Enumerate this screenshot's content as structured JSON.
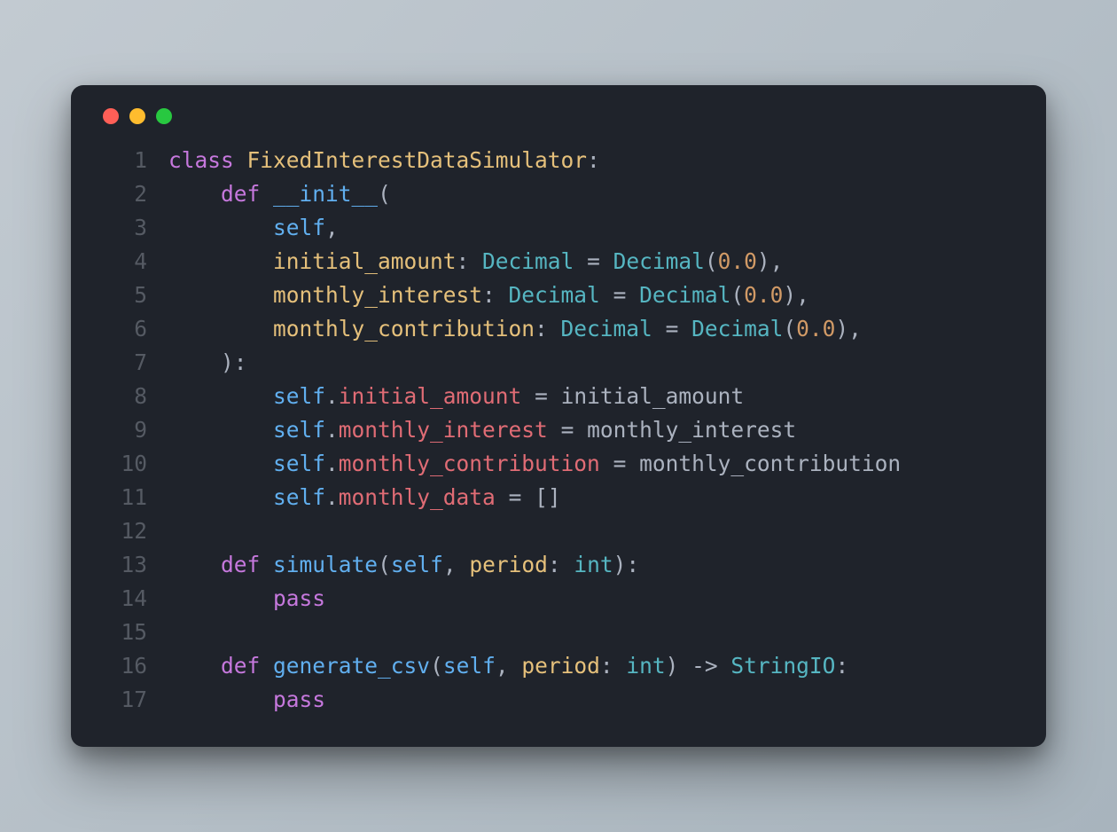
{
  "lines": [
    {
      "n": 1,
      "tokens": [
        [
          "kw",
          "class"
        ],
        [
          "op",
          " "
        ],
        [
          "cls",
          "FixedInterestDataSimulator"
        ],
        [
          "op",
          ":"
        ]
      ]
    },
    {
      "n": 2,
      "tokens": [
        [
          "op",
          "    "
        ],
        [
          "kw",
          "def"
        ],
        [
          "op",
          " "
        ],
        [
          "fn",
          "__init__"
        ],
        [
          "op",
          "("
        ]
      ]
    },
    {
      "n": 3,
      "tokens": [
        [
          "op",
          "        "
        ],
        [
          "slf",
          "self"
        ],
        [
          "op",
          ","
        ]
      ]
    },
    {
      "n": 4,
      "tokens": [
        [
          "op",
          "        "
        ],
        [
          "prm",
          "initial_amount"
        ],
        [
          "op",
          ": "
        ],
        [
          "typ",
          "Decimal"
        ],
        [
          "op",
          " = "
        ],
        [
          "call",
          "Decimal"
        ],
        [
          "op",
          "("
        ],
        [
          "num",
          "0.0"
        ],
        [
          "op",
          "),"
        ]
      ]
    },
    {
      "n": 5,
      "tokens": [
        [
          "op",
          "        "
        ],
        [
          "prm",
          "monthly_interest"
        ],
        [
          "op",
          ": "
        ],
        [
          "typ",
          "Decimal"
        ],
        [
          "op",
          " = "
        ],
        [
          "call",
          "Decimal"
        ],
        [
          "op",
          "("
        ],
        [
          "num",
          "0.0"
        ],
        [
          "op",
          "),"
        ]
      ]
    },
    {
      "n": 6,
      "tokens": [
        [
          "op",
          "        "
        ],
        [
          "prm",
          "monthly_contribution"
        ],
        [
          "op",
          ": "
        ],
        [
          "typ",
          "Decimal"
        ],
        [
          "op",
          " = "
        ],
        [
          "call",
          "Decimal"
        ],
        [
          "op",
          "("
        ],
        [
          "num",
          "0.0"
        ],
        [
          "op",
          "),"
        ]
      ]
    },
    {
      "n": 7,
      "tokens": [
        [
          "op",
          "    ):"
        ]
      ]
    },
    {
      "n": 8,
      "tokens": [
        [
          "op",
          "        "
        ],
        [
          "slf",
          "self"
        ],
        [
          "op",
          "."
        ],
        [
          "attr",
          "initial_amount"
        ],
        [
          "op",
          " = "
        ],
        [
          "id",
          "initial_amount"
        ]
      ]
    },
    {
      "n": 9,
      "tokens": [
        [
          "op",
          "        "
        ],
        [
          "slf",
          "self"
        ],
        [
          "op",
          "."
        ],
        [
          "attr",
          "monthly_interest"
        ],
        [
          "op",
          " = "
        ],
        [
          "id",
          "monthly_interest"
        ]
      ]
    },
    {
      "n": 10,
      "tokens": [
        [
          "op",
          "        "
        ],
        [
          "slf",
          "self"
        ],
        [
          "op",
          "."
        ],
        [
          "attr",
          "monthly_contribution"
        ],
        [
          "op",
          " = "
        ],
        [
          "id",
          "monthly_contribution"
        ]
      ]
    },
    {
      "n": 11,
      "tokens": [
        [
          "op",
          "        "
        ],
        [
          "slf",
          "self"
        ],
        [
          "op",
          "."
        ],
        [
          "attr",
          "monthly_data"
        ],
        [
          "op",
          " = []"
        ]
      ]
    },
    {
      "n": 12,
      "tokens": [
        [
          "op",
          ""
        ]
      ]
    },
    {
      "n": 13,
      "tokens": [
        [
          "op",
          "    "
        ],
        [
          "kw",
          "def"
        ],
        [
          "op",
          " "
        ],
        [
          "fn",
          "simulate"
        ],
        [
          "op",
          "("
        ],
        [
          "slf",
          "self"
        ],
        [
          "op",
          ", "
        ],
        [
          "prm",
          "period"
        ],
        [
          "op",
          ": "
        ],
        [
          "typ",
          "int"
        ],
        [
          "op",
          "):"
        ]
      ]
    },
    {
      "n": 14,
      "tokens": [
        [
          "op",
          "        "
        ],
        [
          "kw",
          "pass"
        ]
      ]
    },
    {
      "n": 15,
      "tokens": [
        [
          "op",
          ""
        ]
      ]
    },
    {
      "n": 16,
      "tokens": [
        [
          "op",
          "    "
        ],
        [
          "kw",
          "def"
        ],
        [
          "op",
          " "
        ],
        [
          "fn",
          "generate_csv"
        ],
        [
          "op",
          "("
        ],
        [
          "slf",
          "self"
        ],
        [
          "op",
          ", "
        ],
        [
          "prm",
          "period"
        ],
        [
          "op",
          ": "
        ],
        [
          "typ",
          "int"
        ],
        [
          "op",
          ") -> "
        ],
        [
          "typ",
          "StringIO"
        ],
        [
          "op",
          ":"
        ]
      ]
    },
    {
      "n": 17,
      "tokens": [
        [
          "op",
          "        "
        ],
        [
          "kw",
          "pass"
        ]
      ]
    }
  ]
}
